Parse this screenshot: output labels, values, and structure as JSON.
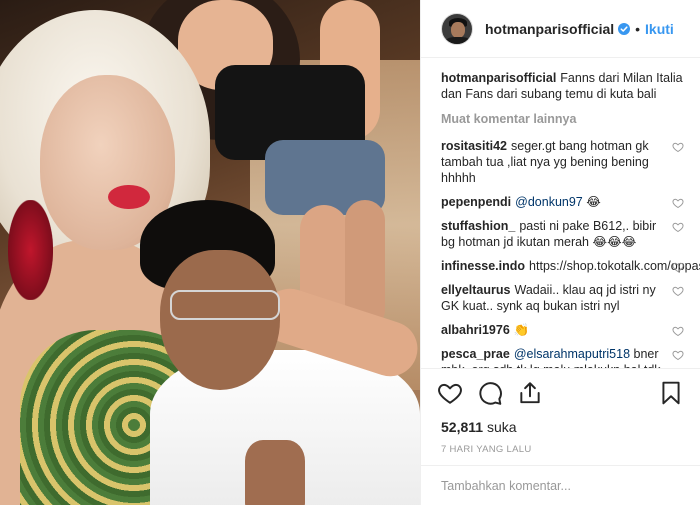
{
  "header": {
    "username": "hotmanparisofficial",
    "separator": "•",
    "follow_label": "Ikuti"
  },
  "caption": {
    "username": "hotmanparisofficial",
    "text": "Fanns dari Milan Italia dan Fans dari subang temu di kuta bali"
  },
  "load_more_label": "Muat komentar lainnya",
  "comments": [
    {
      "username": "rositasiti42",
      "text": "seger.gt bang hotman gk tambah tua ,liat nya yg bening bening hhhhh",
      "mention": ""
    },
    {
      "username": "pepenpendi",
      "text": " 😂",
      "mention": "@donkun97"
    },
    {
      "username": "stuffashion_",
      "text": "pasti ni pake B612,. bibir bg hotman jd ikutan merah 😂😂😂",
      "mention": ""
    },
    {
      "username": "infinesse.indo",
      "text": "https://shop.tokotalk.com/oppashop",
      "mention": ""
    },
    {
      "username": "ellyeltaurus",
      "text": "Wadaii.. klau aq jd istri ny GK kuat.. synk aq bukan istri nyl",
      "mention": ""
    },
    {
      "username": "albahri1976",
      "text": "👏",
      "mention": ""
    },
    {
      "username": "pesca_prae",
      "text": " bner mbk. org sdh tk lg malu mlakukn hal tdk benar. klo mo lakuin ya bwt konsumsi pribadi ai. jgn smpe generasi",
      "mention": "@elsarahmaputri518"
    }
  ],
  "likes": {
    "count": "52,811",
    "label": "suka"
  },
  "time_ago": "7 HARI YANG LALU",
  "add_comment": {
    "placeholder": "Tambahkan komentar..."
  },
  "colors": {
    "link_blue": "#3897f0",
    "mention_blue": "#003569",
    "muted_gray": "#999999",
    "text": "#262626"
  },
  "icons": [
    "verified-badge-icon",
    "heart-icon",
    "comment-icon",
    "share-icon",
    "bookmark-icon"
  ]
}
